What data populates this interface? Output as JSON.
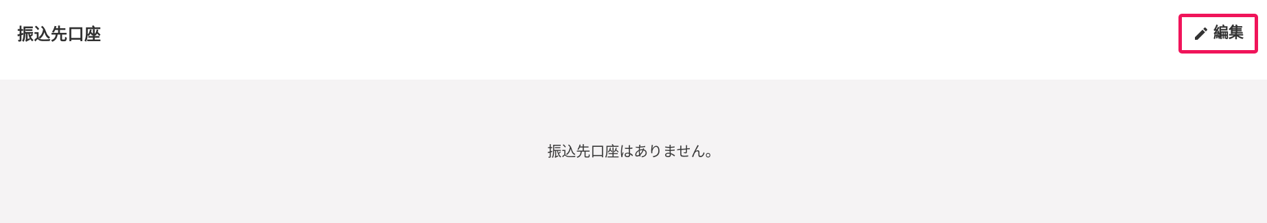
{
  "section": {
    "title": "振込先口座",
    "edit_label": "編集",
    "edit_icon": "pencil-icon",
    "empty_message": "振込先口座はありません。"
  },
  "colors": {
    "highlight_border": "#f0145a",
    "panel_background": "#f5f3f4",
    "text": "#2f2f2f"
  }
}
